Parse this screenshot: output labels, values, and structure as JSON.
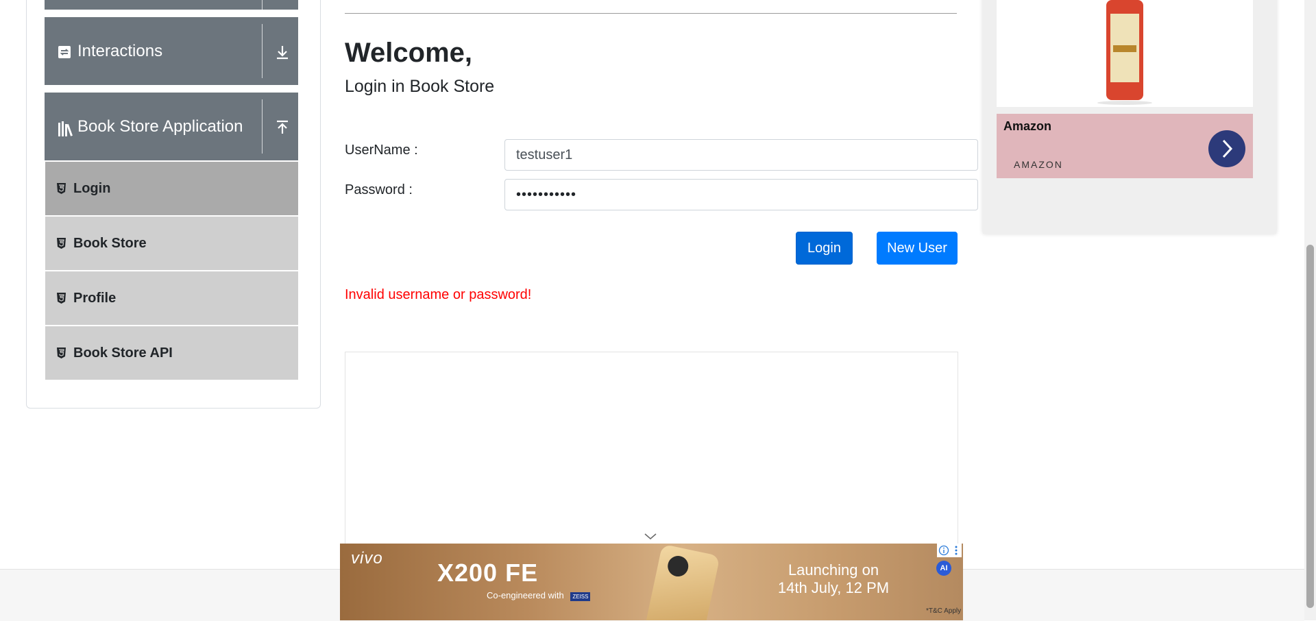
{
  "sidebar": {
    "groups": [
      {
        "title": "Interactions",
        "toggle": "chevron-down-icon"
      },
      {
        "title": "Book Store Application",
        "toggle": "chevron-up-icon"
      }
    ],
    "items": [
      {
        "label": "Login",
        "active": true
      },
      {
        "label": "Book Store",
        "active": false
      },
      {
        "label": "Profile",
        "active": false
      },
      {
        "label": "Book Store API",
        "active": false
      }
    ]
  },
  "main": {
    "welcome": "Welcome,",
    "subtitle": "Login in Book Store",
    "username_label": "UserName :",
    "username_value": "testuser1",
    "password_label": "Password :",
    "password_value": "•••••••••••",
    "login_button": "Login",
    "new_user_button": "New User",
    "error": "Invalid username or password!"
  },
  "side_ad": {
    "advertiser": "Amazon",
    "domain": "AMAZON"
  },
  "bottom_ad": {
    "brand": "vivo",
    "model": "X200 FE",
    "tagline": "Co-engineered with",
    "partner": "ZEISS",
    "launch_line1": "Launching on",
    "launch_line2": "14th July, 12 PM",
    "tc": "*T&C Apply",
    "ai_badge": "AI"
  },
  "colors": {
    "accent": "#007bff",
    "accent_active": "#0069d9",
    "error": "#ff0000",
    "sidebar_header": "#6c757d",
    "menu_item": "#cfcfcf",
    "menu_item_active": "#aaaaaa"
  }
}
